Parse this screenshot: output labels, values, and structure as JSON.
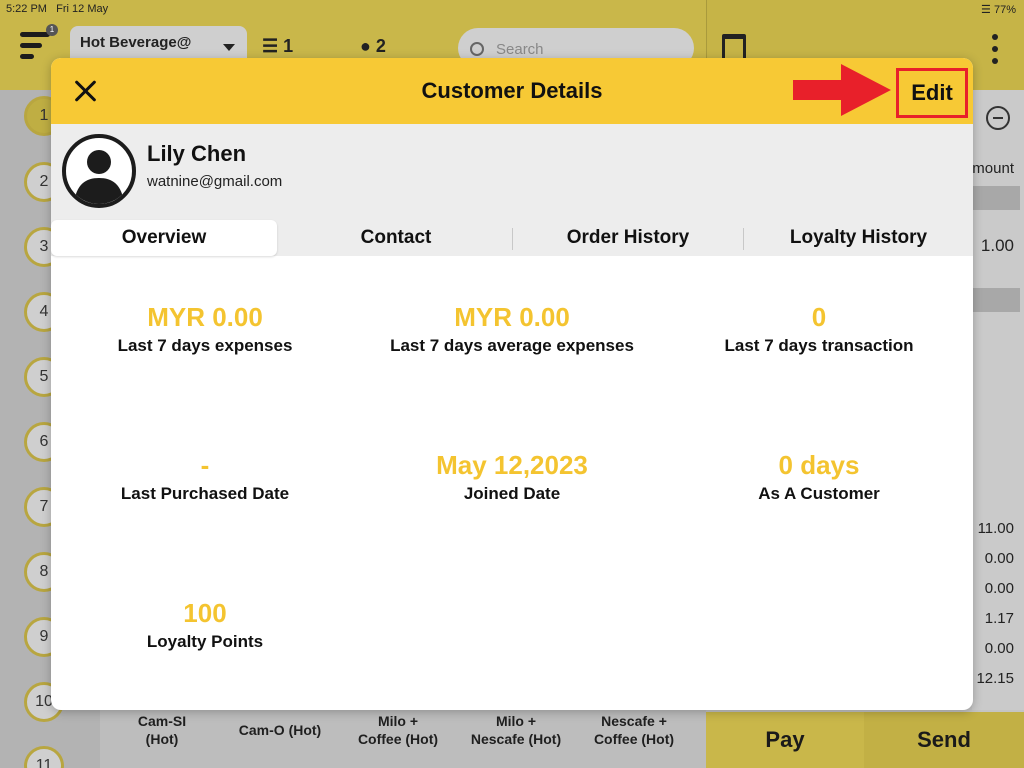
{
  "status_bar": {
    "time": "5:22 PM",
    "date": "Fri 12 May",
    "battery": "77%"
  },
  "background": {
    "menu_badge": "1",
    "outlet_dropdown": "Hot Beverage@",
    "stack_count": "1",
    "tables_count": "2",
    "search_placeholder": "Search",
    "table_numbers": [
      "1",
      "2",
      "3",
      "4",
      "5",
      "6",
      "7",
      "8",
      "9",
      "10",
      "11"
    ],
    "right_panel": {
      "header": "mount",
      "first_amount": "1.00",
      "summary_values": [
        "11.00",
        "0.00",
        "0.00",
        "1.17",
        "0.00",
        "12.15"
      ]
    },
    "products": [
      {
        "line1": "Cam-SI",
        "line2": "(Hot)"
      },
      {
        "line1": "Cam-O (Hot)",
        "line2": ""
      },
      {
        "line1": "Milo +",
        "line2": "Coffee (Hot)"
      },
      {
        "line1": "Milo +",
        "line2": "Nescafe (Hot)"
      },
      {
        "line1": "Nescafe +",
        "line2": "Coffee (Hot)"
      }
    ],
    "pay_label": "Pay",
    "send_label": "Send"
  },
  "modal": {
    "title": "Customer Details",
    "edit_label": "Edit",
    "customer": {
      "name": "Lily Chen",
      "email": "watnine@gmail.com"
    },
    "tabs": [
      {
        "label": "Overview",
        "active": true
      },
      {
        "label": "Contact",
        "active": false
      },
      {
        "label": "Order History",
        "active": false
      },
      {
        "label": "Loyalty History",
        "active": false
      }
    ],
    "stats": [
      {
        "value": "MYR 0.00",
        "label": "Last 7 days expenses"
      },
      {
        "value": "MYR 0.00",
        "label": "Last 7 days average expenses"
      },
      {
        "value": "0",
        "label": "Last 7 days transaction"
      },
      {
        "value": "-",
        "label": "Last Purchased Date"
      },
      {
        "value": "May 12,2023",
        "label": "Joined Date"
      },
      {
        "value": "0 days",
        "label": "As A Customer"
      },
      {
        "value": "100",
        "label": "Loyalty Points"
      }
    ]
  },
  "colors": {
    "accent_yellow": "#f7c935",
    "value_yellow": "#f4c430",
    "highlight_red": "#e8202a"
  },
  "icons": [
    "menu-icon",
    "layers-icon",
    "chef-icon",
    "search-icon",
    "trash-icon",
    "more-icon",
    "close-icon",
    "user-avatar-icon",
    "red-arrow-icon"
  ]
}
